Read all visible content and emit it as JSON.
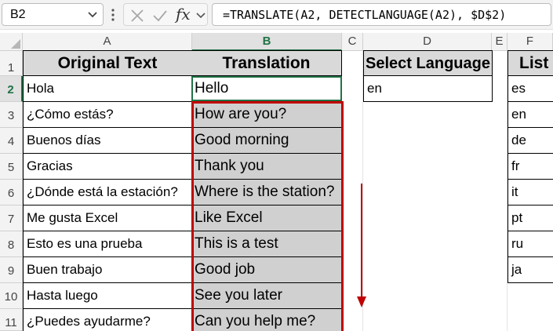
{
  "formula_bar": {
    "name_box": "B2",
    "fx_label": "fx",
    "formula": "=TRANSLATE(A2, DETECTLANGUAGE(A2), $D$2)"
  },
  "columns": [
    "A",
    "B",
    "C",
    "D",
    "E",
    "F"
  ],
  "rows": [
    "1",
    "2",
    "3",
    "4",
    "5",
    "6",
    "7",
    "8",
    "9",
    "10",
    "11"
  ],
  "headers": {
    "original": "Original Text",
    "translation": "Translation",
    "select_language": "Select Language",
    "list": "List"
  },
  "original_text": [
    "Hola",
    "¿Cómo estás?",
    "Buenos días",
    "Gracias",
    "¿Dónde está la estación?",
    "Me gusta Excel",
    "Esto es una prueba",
    "Buen trabajo",
    "Hasta luego",
    "¿Puedes ayudarme?"
  ],
  "translation": [
    "Hello",
    "How are you?",
    "Good morning",
    "Thank you",
    "Where is the station?",
    "Like Excel",
    "This is a test",
    "Good job",
    "See you later",
    "Can you help me?"
  ],
  "select_language_value": "en",
  "language_list": [
    "es",
    "en",
    "de",
    "fr",
    "it",
    "pt",
    "ru",
    "ja"
  ],
  "colors": {
    "accent": "#217346",
    "highlight_border": "#c00000",
    "fill_grey": "#d0d0d0"
  }
}
